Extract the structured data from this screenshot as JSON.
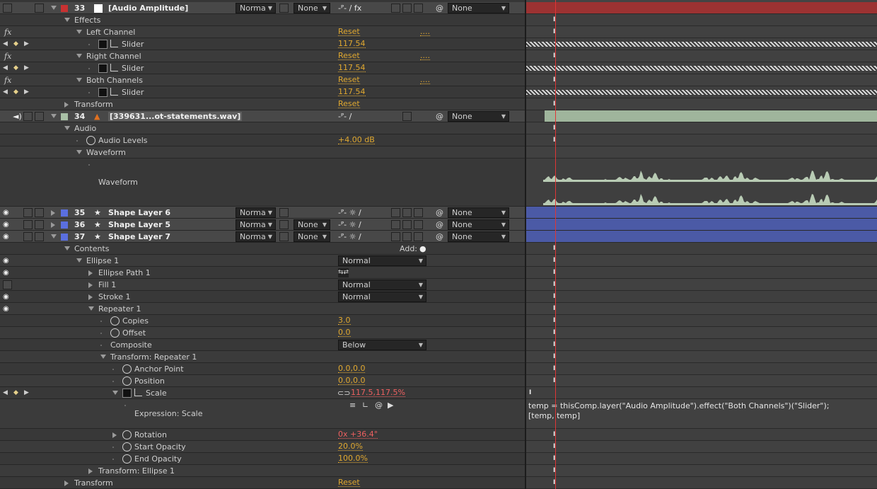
{
  "colors": {
    "value": "#d09c2c",
    "value_red": "#e05a5a",
    "playhead": "#d03030",
    "audio_layer_bar": "#9fb59c",
    "solid_layer_bar": "#9c3232",
    "shape_layer_bar": "#4b5aa6"
  },
  "rows": [
    {
      "kind": "layer",
      "num": "33",
      "label": "[Audio Amplitude]",
      "swatch": "#c83232",
      "src_icon": "solid-white",
      "mode": "Norma",
      "trkmat": "None",
      "switches": "-ᴾ- / fx",
      "parent": "None",
      "left": "box"
    },
    {
      "kind": "prop",
      "lvl": 1,
      "tw": "open",
      "label": "Effects"
    },
    {
      "kind": "prop",
      "lvl": 2,
      "tw": "open",
      "label": "Left Channel",
      "value": "Reset",
      "extra": "....",
      "left": "fx"
    },
    {
      "kind": "prop",
      "lvl": 3,
      "tw": "none",
      "sw": "box",
      "graph": true,
      "label": "Slider",
      "value": "117.54",
      "left": "kf"
    },
    {
      "kind": "prop",
      "lvl": 2,
      "tw": "open",
      "label": "Right Channel",
      "value": "Reset",
      "extra": "....",
      "left": "fx"
    },
    {
      "kind": "prop",
      "lvl": 3,
      "tw": "none",
      "sw": "box",
      "graph": true,
      "label": "Slider",
      "value": "117.54",
      "left": "kf"
    },
    {
      "kind": "prop",
      "lvl": 2,
      "tw": "open",
      "label": "Both Channels",
      "value": "Reset",
      "extra": "....",
      "left": "fx"
    },
    {
      "kind": "prop",
      "lvl": 3,
      "tw": "none",
      "sw": "box",
      "graph": true,
      "label": "Slider",
      "value": "117.54",
      "left": "kf"
    },
    {
      "kind": "prop",
      "lvl": 1,
      "tw": "closed",
      "label": "Transform",
      "value": "Reset"
    },
    {
      "kind": "layer",
      "num": "34",
      "label": "[339631...ot-statements.wav]",
      "swatch": "#a9c0a6",
      "src_icon": "vlc-cone",
      "switches": "-ᴾ- /",
      "parent": "None",
      "left": "audio"
    },
    {
      "kind": "prop",
      "lvl": 1,
      "tw": "open",
      "label": "Audio"
    },
    {
      "kind": "prop",
      "lvl": 2,
      "tw": "none",
      "sw": "round",
      "label": "Audio Levels",
      "value": "+4.00 dB"
    },
    {
      "kind": "prop",
      "lvl": 2,
      "tw": "open",
      "label": "Waveform"
    },
    {
      "kind": "wave",
      "lvl": 3,
      "tw": "none",
      "label": "Waveform"
    },
    {
      "kind": "layer",
      "num": "35",
      "label": "Shape Layer 6",
      "swatch": "#5a6fe0",
      "src_icon": "star",
      "mode": "Norma",
      "trkmat_box": true,
      "switches": "-ᴾ- ☼ /",
      "parent": "None",
      "left": "eye",
      "tw": "closed"
    },
    {
      "kind": "layer",
      "num": "36",
      "label": "Shape Layer 5",
      "swatch": "#5a6fe0",
      "src_icon": "star",
      "mode": "Norma",
      "trkmat": "None",
      "switches": "-ᴾ- ☼ /",
      "parent": "None",
      "left": "eye",
      "tw": "closed"
    },
    {
      "kind": "layer",
      "num": "37",
      "label": "Shape Layer 7",
      "swatch": "#5a6fe0",
      "src_icon": "star",
      "mode": "Norma",
      "trkmat": "None",
      "switches": "-ᴾ- ☼ /",
      "parent": "None",
      "left": "eye",
      "tw": "open"
    },
    {
      "kind": "prop",
      "lvl": 1,
      "tw": "open",
      "label": "Contents",
      "add": "Add:"
    },
    {
      "kind": "prop",
      "lvl": 2,
      "tw": "open",
      "label": "Ellipse 1",
      "dropdown": "Normal",
      "left": "eye"
    },
    {
      "kind": "prop",
      "lvl": 3,
      "tw": "closed",
      "label": "Ellipse Path 1",
      "pathdir": true,
      "left": "eye"
    },
    {
      "kind": "prop",
      "lvl": 3,
      "tw": "closed",
      "label": "Fill 1",
      "dropdown": "Normal",
      "left": "box"
    },
    {
      "kind": "prop",
      "lvl": 3,
      "tw": "closed",
      "label": "Stroke 1",
      "dropdown": "Normal",
      "left": "eye"
    },
    {
      "kind": "prop",
      "lvl": 3,
      "tw": "open",
      "label": "Repeater 1",
      "left": "eye"
    },
    {
      "kind": "prop",
      "lvl": 4,
      "tw": "none",
      "sw": "round",
      "label": "Copies",
      "value": "3.0"
    },
    {
      "kind": "prop",
      "lvl": 4,
      "tw": "none",
      "sw": "round",
      "label": "Offset",
      "value": "0.0"
    },
    {
      "kind": "prop",
      "lvl": 4,
      "tw": "none",
      "label": "Composite",
      "dropdown": "Below"
    },
    {
      "kind": "prop",
      "lvl": 4,
      "tw": "open",
      "label": "Transform: Repeater 1"
    },
    {
      "kind": "prop",
      "lvl": 5,
      "tw": "none",
      "sw": "round",
      "label": "Anchor Point",
      "value": "0.0,0.0"
    },
    {
      "kind": "prop",
      "lvl": 5,
      "tw": "none",
      "sw": "round",
      "label": "Position",
      "value": "0.0,0.0"
    },
    {
      "kind": "prop",
      "lvl": 5,
      "tw": "open",
      "sw": "box",
      "graph": true,
      "label": "Scale",
      "value": "117.5,117.5%",
      "red": true,
      "link": true,
      "left": "kf"
    },
    {
      "kind": "expr",
      "lvl": 6,
      "tw": "none",
      "label": "Expression: Scale",
      "code": [
        "temp = thisComp.layer(\"Audio Amplitude\").effect(\"Both Channels\")(\"Slider\");",
        "[temp, temp]"
      ]
    },
    {
      "kind": "prop",
      "lvl": 5,
      "tw": "closed",
      "sw": "round",
      "label": "Rotation",
      "value": "0x +36.4°",
      "red": true
    },
    {
      "kind": "prop",
      "lvl": 5,
      "tw": "none",
      "sw": "round",
      "label": "Start Opacity",
      "value": "20.0%"
    },
    {
      "kind": "prop",
      "lvl": 5,
      "tw": "none",
      "sw": "round",
      "label": "End Opacity",
      "value": "100.0%"
    },
    {
      "kind": "prop",
      "lvl": 3,
      "tw": "closed",
      "label": "Transform: Ellipse 1"
    },
    {
      "kind": "prop",
      "lvl": 1,
      "tw": "closed",
      "label": "Transform",
      "value": "Reset"
    }
  ]
}
